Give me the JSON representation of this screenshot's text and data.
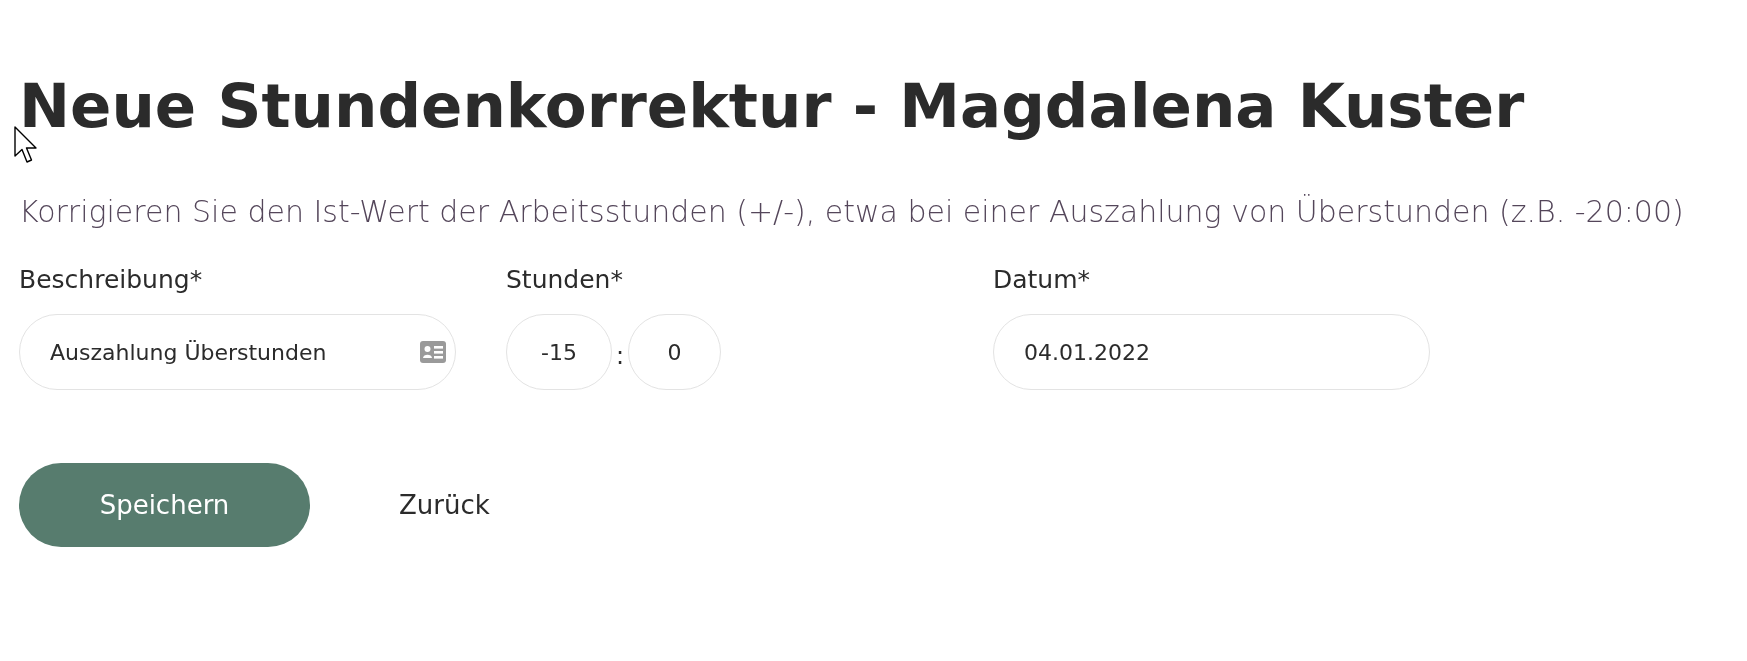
{
  "title": "Neue Stundenkorrektur - Magdalena Kuster",
  "description": "Korrigieren Sie den Ist-Wert der Arbeitsstunden (+/-), etwa bei einer Auszahlung von Überstunden (z.B. -20:00)",
  "fields": [
    {
      "kind": "text",
      "label": "Beschreibung*",
      "value": "Auszahlung Überstunden"
    },
    {
      "kind": "time",
      "label": "Stunden*",
      "hours": "-15",
      "separator": ":",
      "minutes": "0"
    },
    {
      "kind": "date",
      "label": "Datum*",
      "value": "04.01.2022"
    }
  ],
  "buttons": [
    {
      "kind": "primary",
      "label": "Speichern"
    },
    {
      "kind": "link",
      "label": "Zurück"
    }
  ]
}
